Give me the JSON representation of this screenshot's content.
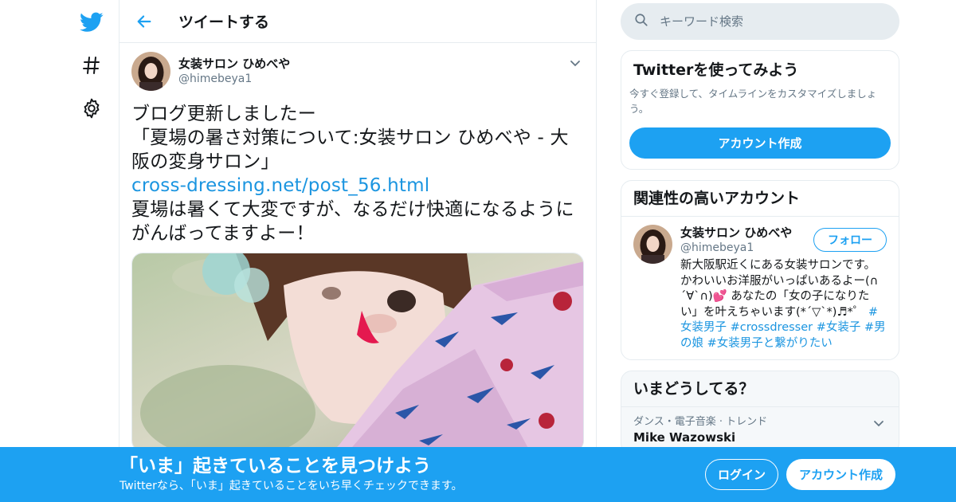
{
  "colors": {
    "accent": "#1da1f2",
    "link": "#1b95e0",
    "secondary_text": "#657786",
    "border": "#e6ecf0"
  },
  "nav": {
    "icons": [
      "twitter-bird-icon",
      "hashtag-icon",
      "gear-icon"
    ]
  },
  "header": {
    "title": "ツイートする"
  },
  "tweet": {
    "author_name": "女装サロン ひめべや",
    "author_handle": "@himebeya1",
    "text_lines": [
      "ブログ更新しましたー",
      "「夏場の暑さ対策について:女装サロン ひめべや - 大",
      "阪の変身サロン」"
    ],
    "link": "cross-dressing.net/post_56.html",
    "text_lines_after": [
      "夏場は暑くて大変ですが、なるだけ快適になるように",
      "がんばってますよー！"
    ]
  },
  "search": {
    "placeholder": "キーワード検索"
  },
  "signup_card": {
    "title": "Twitterを使ってみよう",
    "desc": "今すぐ登録して、タイムラインをカスタマイズしましょう。",
    "button": "アカウント作成"
  },
  "related": {
    "title": "関連性の高いアカウント",
    "user_name": "女装サロン ひめべや",
    "user_handle": "@himebeya1",
    "follow_label": "フォロー",
    "bio_line1": "新大阪駅近くにある女装サロンです。",
    "bio_line2": "かわいいお洋服がいっぱいあるよー(∩",
    "bio_line3a": "´∀`∩)💕 あなたの「女の子になりた",
    "bio_line4a": "い」を叶えちゃいます(*´▽`*)♬*゜",
    "bio_tag1": "#",
    "bio_tag2": "女装男子",
    "bio_tag3": "#crossdresser",
    "bio_tag4": "#女装子",
    "bio_tag5": "#男",
    "bio_tag6": "の娘",
    "bio_tag7": "#女装男子と繋がりたい"
  },
  "trends": {
    "title": "いまどうしてる？",
    "items": [
      {
        "meta": "ダンス・電子音楽 · トレンド",
        "name": "Mike Wazowski"
      }
    ]
  },
  "bottom_bar": {
    "title": "「いま」起きていることを見つけよう",
    "subtitle": "Twitterなら、「いま」起きていることをいち早くチェックできます。",
    "login": "ログイン",
    "signup": "アカウント作成"
  }
}
